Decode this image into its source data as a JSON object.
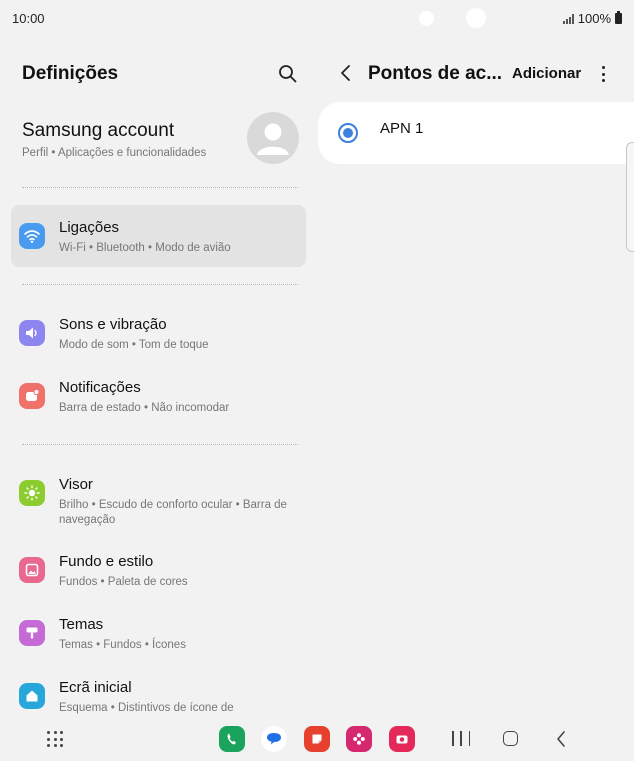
{
  "status_bar": {
    "time": "10:00",
    "battery": "100%"
  },
  "left_pane": {
    "title": "Definições",
    "account": {
      "name": "Samsung account",
      "subtitle": "Perfil  •  Aplicações e funcionalidades"
    },
    "items": [
      {
        "title": "Ligações",
        "subtitle": "Wi-Fi  •  Bluetooth  •  Modo de avião",
        "icon": "wifi-icon",
        "color": "#4a9bf0",
        "selected": true
      },
      {
        "title": "Sons e vibração",
        "subtitle": "Modo de som  •  Tom de toque",
        "icon": "speaker-icon",
        "color": "#8d86f0"
      },
      {
        "title": "Notificações",
        "subtitle": "Barra de estado  •  Não incomodar",
        "icon": "notification-icon",
        "color": "#f0706a"
      },
      {
        "title": "Visor",
        "subtitle": "Brilho  •  Escudo de conforto ocular  •  Barra de navegação",
        "icon": "brightness-icon",
        "color": "#8ccc2e"
      },
      {
        "title": "Fundo e estilo",
        "subtitle": "Fundos  •  Paleta de cores",
        "icon": "wallpaper-icon",
        "color": "#e8698d"
      },
      {
        "title": "Temas",
        "subtitle": "Temas  •  Fundos  •  Ícones",
        "icon": "themes-icon",
        "color": "#c56bd6"
      },
      {
        "title": "Ecrã inicial",
        "subtitle": "Esquema  •  Distintivos de ícone de",
        "icon": "home-screen-icon",
        "color": "#27a6d9"
      }
    ]
  },
  "right_pane": {
    "title": "Pontos de ac...",
    "add_label": "Adicionar",
    "apn_items": [
      {
        "label": "APN 1",
        "selected": true
      }
    ],
    "accent": "#3e7fe0"
  },
  "dock": {
    "apps": [
      {
        "icon": "phone-app-icon",
        "color": "#1aa35c"
      },
      {
        "icon": "messages-app-icon",
        "color": "#1f6fe5"
      },
      {
        "icon": "notes-app-icon",
        "color": "#e8402e"
      },
      {
        "icon": "gallery-app-icon",
        "color": "#d6286e"
      },
      {
        "icon": "camera-app-icon",
        "color": "#e5285a"
      }
    ]
  }
}
